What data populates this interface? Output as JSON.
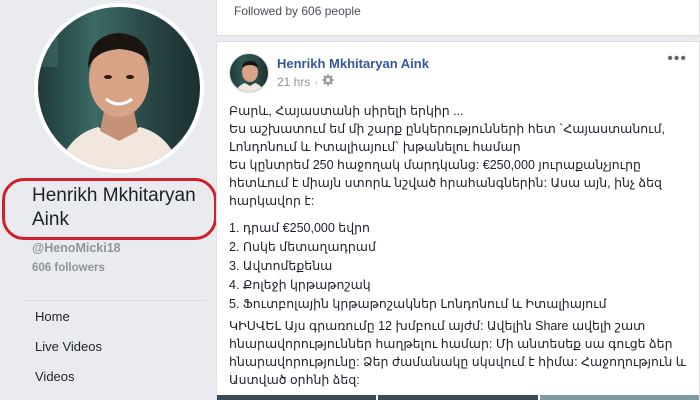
{
  "profile": {
    "name": "Henrikh Mkhitaryan Aink",
    "handle": "@HenoMicki18",
    "followers": "606 followers"
  },
  "nav": {
    "items": [
      {
        "label": "Home"
      },
      {
        "label": "Live Videos"
      },
      {
        "label": "Videos"
      }
    ]
  },
  "header": {
    "followed_by": "Followed by 606 people"
  },
  "post": {
    "author": "Henrikh Mkhitaryan Aink",
    "time": "21 hrs",
    "time_separator": "·",
    "intro_lines": [
      "Բարև, Հայաստանի սիրելի երկիր ...",
      "Ես աշխատում եմ մի շարք ընկերությունների հետ `Հայաստանում,",
      "Լոնդոնում և Իտալիայում` խթանելու համար",
      "Ես կընտրեմ 250 հաջողակ մարդկանց: €250,000 յուրաքանչյուրը",
      "հետևում է միայն ստորև նշված հրահանգներին: Ասա այն, ինչ ձեզ",
      "հարկավոր է:"
    ],
    "list": [
      "1. դրամ €250,000 եվրո",
      "2. Ոսկե մետաղադրամ",
      "3. Ավտոմեքենա",
      "4. Քոլեջի կրթաթոշակ",
      "5. Ֆուտբոլային կրթաթոշակներ Լոնդոնում և Իտալիայում"
    ],
    "footer_lines": [
      "ԿԻՍՎԵԼ Այս գրառումը 12 խմբում այժմ: Ավելին Share ավելի շատ",
      "հնարավորություններ հաղթելու համար: Մի անտեսեք սա գուցե ձեր",
      "հնարավորությունը: Ձեր ժամանակը սկսվում է հիմա: Հաջողություն և",
      "Աստված օրհնի ձեզ:"
    ]
  },
  "colors": {
    "background": "#e9ebee",
    "link_blue": "#365899",
    "highlight_red": "#d0202c"
  }
}
